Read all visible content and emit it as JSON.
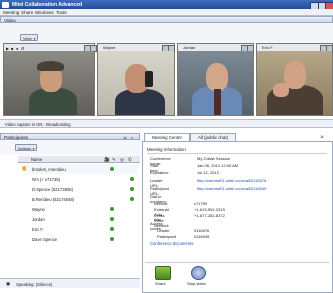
{
  "app": {
    "title": "Mitel Collaboration Advanced"
  },
  "menu": [
    "Meeting",
    "Share",
    "Windows",
    "Tools"
  ],
  "video_panel": {
    "title": "Video",
    "view_button": "View"
  },
  "tiles": [
    {
      "name": ""
    },
    {
      "name": "Wayne"
    },
    {
      "name": "Jordan"
    },
    {
      "name": "Eric F."
    }
  ],
  "video_status": "Video capture is ON  -  Broadcasting",
  "participants": {
    "title": "Participants",
    "actions_label": "Actions",
    "header_name": "Name",
    "rows": [
      {
        "name": "brookrs, mrendieu"
      },
      {
        "name": "N/A (+ x71745)"
      },
      {
        "name": "D.Spence (52173838)"
      },
      {
        "name": "B.Rendieu (52174048)"
      },
      {
        "name": "Wayne"
      },
      {
        "name": "Jordan"
      },
      {
        "name": "Eric F."
      },
      {
        "name": "Dave Spence"
      }
    ],
    "speaking": "Speaking: (Silence)"
  },
  "meeting_center": {
    "tabs": [
      "Meeting Center",
      "All (public chat)"
    ],
    "section_title": "Meeting Information",
    "info": [
      {
        "k": "Conference name:",
        "v": "My Collab Session"
      },
      {
        "k": "Start time:",
        "v": "Jan 06, 2012  12:00 AM"
      },
      {
        "k": "Expiration:",
        "v": "Jul 12, 2012"
      },
      {
        "k": "Leader URL:",
        "v": "http://camnet01.mitel.com/call/0116576"
      },
      {
        "k": "Participant URL:",
        "v": "http://camnet01.mitel.com/call/0116549"
      },
      {
        "k": "Dial-in numbers:",
        "v": ""
      },
      {
        "k": "Internal",
        "v": "x71790"
      },
      {
        "k": "External Auto Attn",
        "v": "+1-613-591-2315"
      },
      {
        "k": "Cross Voice Network",
        "v": "+1-877-282-8372"
      },
      {
        "k": "Access codes:",
        "v": ""
      },
      {
        "k": "Leader",
        "v": "0116576"
      },
      {
        "k": "Participant",
        "v": "0116549"
      }
    ],
    "documents_link": "Conference documents",
    "share_button": "Share",
    "stop_video_button": "Stop video"
  }
}
